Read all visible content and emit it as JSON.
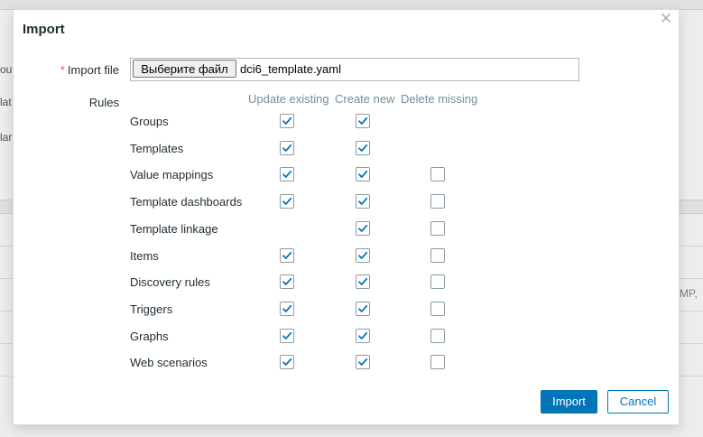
{
  "background": {
    "left_fragments": [
      "ou",
      "lat",
      "lar"
    ],
    "right_fragment": "MP,"
  },
  "dialog": {
    "title": "Import",
    "close_icon": "close-icon",
    "import_file": {
      "required_mark": "*",
      "label": "Import file",
      "button_label": "Выберите файл",
      "file_name": "dci6_template.yaml"
    },
    "rules": {
      "label": "Rules",
      "columns": [
        "Update existing",
        "Create new",
        "Delete missing"
      ],
      "rows": [
        {
          "name": "Groups",
          "update": true,
          "create": true,
          "delete": null
        },
        {
          "name": "Templates",
          "update": true,
          "create": true,
          "delete": null
        },
        {
          "name": "Value mappings",
          "update": true,
          "create": true,
          "delete": false
        },
        {
          "name": "Template dashboards",
          "update": true,
          "create": true,
          "delete": false
        },
        {
          "name": "Template linkage",
          "update": null,
          "create": true,
          "delete": false
        },
        {
          "name": "Items",
          "update": true,
          "create": true,
          "delete": false
        },
        {
          "name": "Discovery rules",
          "update": true,
          "create": true,
          "delete": false
        },
        {
          "name": "Triggers",
          "update": true,
          "create": true,
          "delete": false
        },
        {
          "name": "Graphs",
          "update": true,
          "create": true,
          "delete": false
        },
        {
          "name": "Web scenarios",
          "update": true,
          "create": true,
          "delete": false
        }
      ]
    },
    "buttons": {
      "import_label": "Import",
      "cancel_label": "Cancel"
    },
    "colors": {
      "accent": "#0275b8",
      "check": "#0275b8",
      "required": "#e45959"
    }
  }
}
